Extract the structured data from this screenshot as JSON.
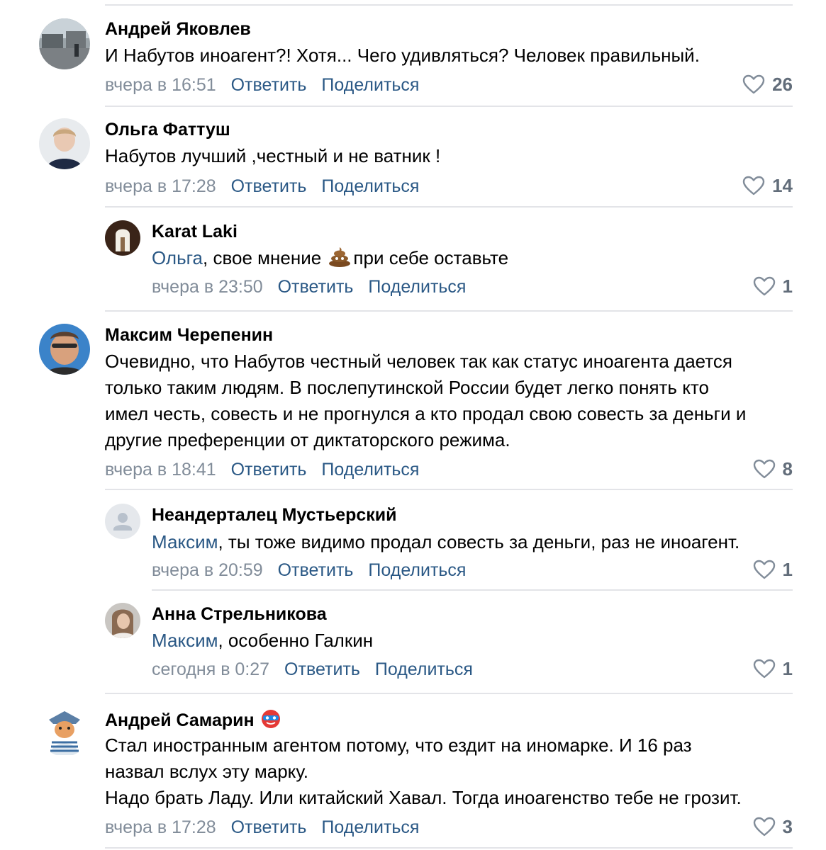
{
  "comments": [
    {
      "author": "Андрей Яковлев",
      "text": "И Набутов иноагент?! Хотя... Чего удивляться? Человек правильный.",
      "time": "вчера в 16:51",
      "reply": "Ответить",
      "share": "Поделиться",
      "likes": "26"
    },
    {
      "author": "Ольга Фаттуш",
      "text": "Набутов лучший ,честный и не ватник !",
      "time": "вчера в 17:28",
      "reply": "Ответить",
      "share": "Поделиться",
      "likes": "14"
    },
    {
      "author": "Karat Laki",
      "mention": "Ольга",
      "text_before_emoji": ", свое мнение",
      "emoji_icon": "poop-emoji-icon",
      "text_after_emoji": "при себе оставьте",
      "time": "вчера в 23:50",
      "reply": "Ответить",
      "share": "Поделиться",
      "likes": "1"
    },
    {
      "author": "Максим Черепенин",
      "lines": [
        "Очевидно, что Набутов честный человек так как статус иноагента дается",
        "только таким людям. В послепутинской России будет легко понять кто",
        "имел честь, совесть и не прогнулся а кто продал свою совесть за деньги и",
        "другие преференции от диктаторского режима."
      ],
      "time": "вчера в 18:41",
      "reply": "Ответить",
      "share": "Поделиться",
      "likes": "8"
    },
    {
      "author": "Неандерталец Мустьерский",
      "mention": "Максим",
      "text": ", ты тоже видимо продал совесть за деньги, раз не иноагент.",
      "time": "вчера в 20:59",
      "reply": "Ответить",
      "share": "Поделиться",
      "likes": "1"
    },
    {
      "author": "Анна Стрельникова",
      "mention": "Максим",
      "text": ", особенно Галкин",
      "time": "сегодня в 0:27",
      "reply": "Ответить",
      "share": "Поделиться",
      "likes": "1"
    },
    {
      "author": "Андрей Самарин",
      "badge_icon": "mask-emoji-icon",
      "lines": [
        "Стал иностранным агентом потому, что ездит на иномарке. И 16 раз",
        "назвал вслух эту марку.",
        "Надо брать Ладу. Или китайский Хавал. Тогда иноагенство тебе не грозит."
      ],
      "time": "вчера в 17:28",
      "reply": "Ответить",
      "share": "Поделиться",
      "likes": "3"
    }
  ],
  "colors": {
    "link": "#2a5885",
    "meta": "#818c99",
    "likes": "#626d7a",
    "divider": "#e3e4e8"
  },
  "icons": {
    "like": "heart-outline-icon",
    "placeholder_avatar": "user-silhouette-icon"
  }
}
